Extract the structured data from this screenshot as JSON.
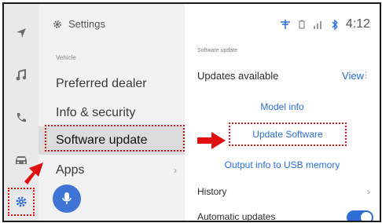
{
  "colors": {
    "accent": "#2d6ed6",
    "annotation": "#e01010",
    "active_row": "#dcdcdc"
  },
  "rail": {
    "items": [
      "navigation-arrow-icon",
      "music-note-icon",
      "phone-icon",
      "car-icon",
      "gear-icon"
    ]
  },
  "menu": {
    "header": "Settings",
    "section": "Vehicle",
    "items": [
      {
        "label": "Preferred dealer"
      },
      {
        "label": "Info & security"
      },
      {
        "label": "Software update",
        "active": true
      },
      {
        "label": "Apps",
        "chevron": "›"
      }
    ]
  },
  "status": {
    "time": "4:12",
    "icons": [
      "antenna-icon",
      "battery-icon",
      "signal-bars-icon",
      "bluetooth-icon"
    ]
  },
  "content": {
    "section": "Software update",
    "updates_title": "Updates available",
    "view_label": "View",
    "kebab": "⋮",
    "model_info": "Model info",
    "update_software": "Update Software",
    "output_usb": "Output info to USB memory",
    "history": "History",
    "history_chevron": "›",
    "automatic_updates": "Automatic updates",
    "automatic_updates_on": true
  }
}
